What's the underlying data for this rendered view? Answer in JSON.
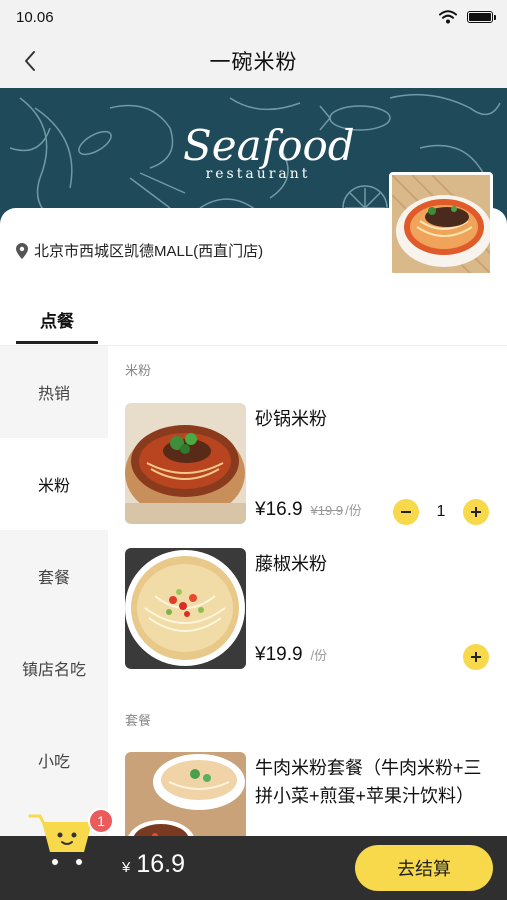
{
  "status_bar": {
    "time": "10.06"
  },
  "nav": {
    "title": "一碗米粉"
  },
  "banner": {
    "logo_script": "Seafood",
    "logo_sub": "restaurant"
  },
  "shop": {
    "address": "北京市西城区凯德MALL(西直门店)"
  },
  "tabs": {
    "order": "点餐"
  },
  "sidebar": {
    "items": [
      {
        "label": "热销"
      },
      {
        "label": "米粉"
      },
      {
        "label": "套餐"
      },
      {
        "label": "镇店名吃"
      },
      {
        "label": "小吃"
      }
    ],
    "active_index": 1
  },
  "sections": [
    {
      "title": "米粉",
      "dishes": [
        {
          "name": "砂锅米粉",
          "price": "¥16.9",
          "original_price": "¥19.9",
          "unit": "/份",
          "quantity": "1"
        },
        {
          "name": "藤椒米粉",
          "price": "¥19.9",
          "unit": "/份"
        }
      ]
    },
    {
      "title": "套餐",
      "dishes": [
        {
          "name": "牛肉米粉套餐（牛肉米粉+三拼小菜+煎蛋+苹果汁饮料）"
        }
      ]
    }
  ],
  "cart": {
    "badge_count": "1",
    "currency": "¥",
    "total": "16.9",
    "checkout_label": "去结算"
  },
  "colors": {
    "accent": "#f8d94b",
    "banner": "#1e4a5a",
    "bottom_bar": "#2f2f2f",
    "badge": "#ec5b5b"
  },
  "icons": [
    "back-chevron-icon",
    "wifi-icon",
    "battery-icon",
    "location-pin-icon",
    "minus-icon",
    "plus-icon",
    "shopping-cart-icon"
  ]
}
